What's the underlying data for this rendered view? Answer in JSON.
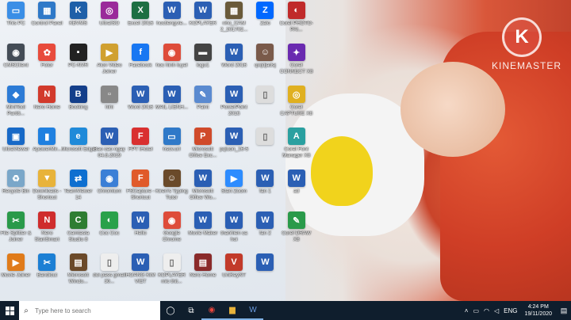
{
  "watermark": {
    "brand": "KINEMASTER",
    "logo_letter": "K"
  },
  "desktop_icons": [
    {
      "label": "This PC",
      "color": "#3a8ee6",
      "glyph": "▭"
    },
    {
      "label": "CMSClient",
      "color": "#444c56",
      "glyph": "◉"
    },
    {
      "label": "MiniTool Partiti...",
      "color": "#2c7bd6",
      "glyph": "◆"
    },
    {
      "label": "UltraViewer",
      "color": "#1769c7",
      "glyph": "▣"
    },
    {
      "label": "Recycle Bin",
      "color": "#7aa7c9",
      "glyph": "♻"
    },
    {
      "label": "File Splitter & Joiner",
      "color": "#2a9a4a",
      "glyph": "✂"
    },
    {
      "label": "Movie Joiner",
      "color": "#e07b1a",
      "glyph": "▶"
    },
    {
      "label": "Control Panel",
      "color": "#2f79c8",
      "glyph": "▦"
    },
    {
      "label": "Fotor",
      "color": "#e84b3c",
      "glyph": "✿"
    },
    {
      "label": "Nero Home",
      "color": "#d23a2c",
      "glyph": "N"
    },
    {
      "label": "ApowerMir...",
      "color": "#1f80e0",
      "glyph": "▮"
    },
    {
      "label": "Downloads - Shortcut",
      "color": "#e8b33a",
      "glyph": "▼"
    },
    {
      "label": "Nero StartSmart",
      "color": "#cf2d2d",
      "glyph": "N"
    },
    {
      "label": "Bandicut",
      "color": "#1c7fd4",
      "glyph": "✂"
    },
    {
      "label": "KBVMS",
      "color": "#1e5fa8",
      "glyph": "K"
    },
    {
      "label": "PC-NVR",
      "color": "#222",
      "glyph": "▪"
    },
    {
      "label": "Booking",
      "color": "#143f8a",
      "glyph": "B"
    },
    {
      "label": "Microsoft Edge",
      "color": "#1f8ad9",
      "glyph": "e"
    },
    {
      "label": "TeamViewer 14",
      "color": "#0e6fd0",
      "glyph": "⇄"
    },
    {
      "label": "Camtasia Studio 8",
      "color": "#2e7d32",
      "glyph": "C"
    },
    {
      "label": "Microsoft Windo...",
      "color": "#6b4a2a",
      "glyph": "▤"
    },
    {
      "label": "UltraISO",
      "color": "#9a2a9a",
      "glyph": "◎"
    },
    {
      "label": "Alon Video Joiner",
      "color": "#d0a030",
      "glyph": "▶"
    },
    {
      "label": "hihi",
      "color": "#888",
      "glyph": "▫"
    },
    {
      "label": "Bao cao ngay 04.8.2019",
      "color": "#2b5fb4",
      "glyph": "W"
    },
    {
      "label": "Chromium",
      "color": "#3b7fd6",
      "glyph": "◉"
    },
    {
      "label": "Coc Coc",
      "color": "#2aa14a",
      "glyph": "◐"
    },
    {
      "label": "doi pass gmail 30...",
      "color": "#eee",
      "glyph": "▯"
    },
    {
      "label": "Excel 2016",
      "color": "#1d6f42",
      "glyph": "X"
    },
    {
      "label": "Facebook",
      "color": "#1877f2",
      "glyph": "f"
    },
    {
      "label": "Word 2016",
      "color": "#2b5fb4",
      "glyph": "W"
    },
    {
      "label": "FPT iHotel",
      "color": "#d93030",
      "glyph": "F"
    },
    {
      "label": "FSCapture - Shortcut",
      "color": "#e05a2a",
      "glyph": "F"
    },
    {
      "label": "Hello",
      "color": "#2b5fb4",
      "glyph": "W"
    },
    {
      "label": "HOANG KIM VIET",
      "color": "#2b5fb4",
      "glyph": "W"
    },
    {
      "label": "hoctiengvie...",
      "color": "#2b5fb4",
      "glyph": "W"
    },
    {
      "label": "hoc hinh luyel",
      "color": "#de4c3a",
      "glyph": "◉"
    },
    {
      "label": "MAIL LIENH...",
      "color": "#2b5fb4",
      "glyph": "W"
    },
    {
      "label": "hscv.url",
      "color": "#2f79c8",
      "glyph": "▭"
    },
    {
      "label": "Kiren's Typing Tutor",
      "color": "#6a4a2a",
      "glyph": "☺"
    },
    {
      "label": "Google Chrome",
      "color": "#de4c3a",
      "glyph": "◉"
    },
    {
      "label": "KOPLAYER mic thit...",
      "color": "#eee",
      "glyph": "▯"
    },
    {
      "label": "KOPLAYER",
      "color": "#2b5fb4",
      "glyph": "W"
    },
    {
      "label": "logo1",
      "color": "#444",
      "glyph": "▬"
    },
    {
      "label": "Paint",
      "color": "#5a8ad0",
      "glyph": "✎"
    },
    {
      "label": "Microsoft Office Exc...",
      "color": "#d04a2a",
      "glyph": "P"
    },
    {
      "label": "Microsoft Office Wo...",
      "color": "#2b5fb4",
      "glyph": "W"
    },
    {
      "label": "Movie Maker",
      "color": "#2b5fb4",
      "glyph": "W"
    },
    {
      "label": "Nero Home",
      "color": "#8a2a2a",
      "glyph": "▤"
    },
    {
      "label": "nho_CAM 2_201702...",
      "color": "#6a5a3a",
      "glyph": "▦"
    },
    {
      "label": "Word 2016",
      "color": "#2b5fb4",
      "glyph": "W"
    },
    {
      "label": "PowerPoint 2016",
      "color": "#2b5fb4",
      "glyph": "W"
    },
    {
      "label": "pqluon_16-5",
      "color": "#2b5fb4",
      "glyph": "W"
    },
    {
      "label": "Start Zoom",
      "color": "#2d8cff",
      "glyph": "▶"
    },
    {
      "label": "thanhien ca hoi",
      "color": "#2b5fb4",
      "glyph": "W"
    },
    {
      "label": "UniKeyNT",
      "color": "#c23a2a",
      "glyph": "V"
    },
    {
      "label": "Zalo",
      "color": "#0068ff",
      "glyph": "Z"
    },
    {
      "label": "qwjdjadsj",
      "color": "#7a5a4a",
      "glyph": "☺"
    },
    {
      "label": "",
      "color": "#ddd",
      "glyph": "▯"
    },
    {
      "label": "",
      "color": "#ddd",
      "glyph": "▯"
    },
    {
      "label": "fan 1",
      "color": "#2b5fb4",
      "glyph": "W"
    },
    {
      "label": "fan 2",
      "color": "#2b5fb4",
      "glyph": "W"
    },
    {
      "label": "",
      "color": "#2b5fb4",
      "glyph": "W"
    },
    {
      "label": "Corel PHOTO-PAI...",
      "color": "#c02a2a",
      "glyph": "◐"
    },
    {
      "label": "Corel CONNECT X8",
      "color": "#6a2ab0",
      "glyph": "✦"
    },
    {
      "label": "Corel CAPTURE X8",
      "color": "#e0b020",
      "glyph": "◎"
    },
    {
      "label": "Corel Font Manager X8",
      "color": "#2aa0a0",
      "glyph": "A"
    },
    {
      "label": "ad",
      "color": "#2b5fb4",
      "glyph": "W"
    },
    {
      "label": "Corel DRAW X8",
      "color": "#2a9a4a",
      "glyph": "✎"
    }
  ],
  "taskbar": {
    "search_placeholder": "Type here to search",
    "language": "ENG",
    "time": "4:24 PM",
    "date": "19/11/2020"
  }
}
